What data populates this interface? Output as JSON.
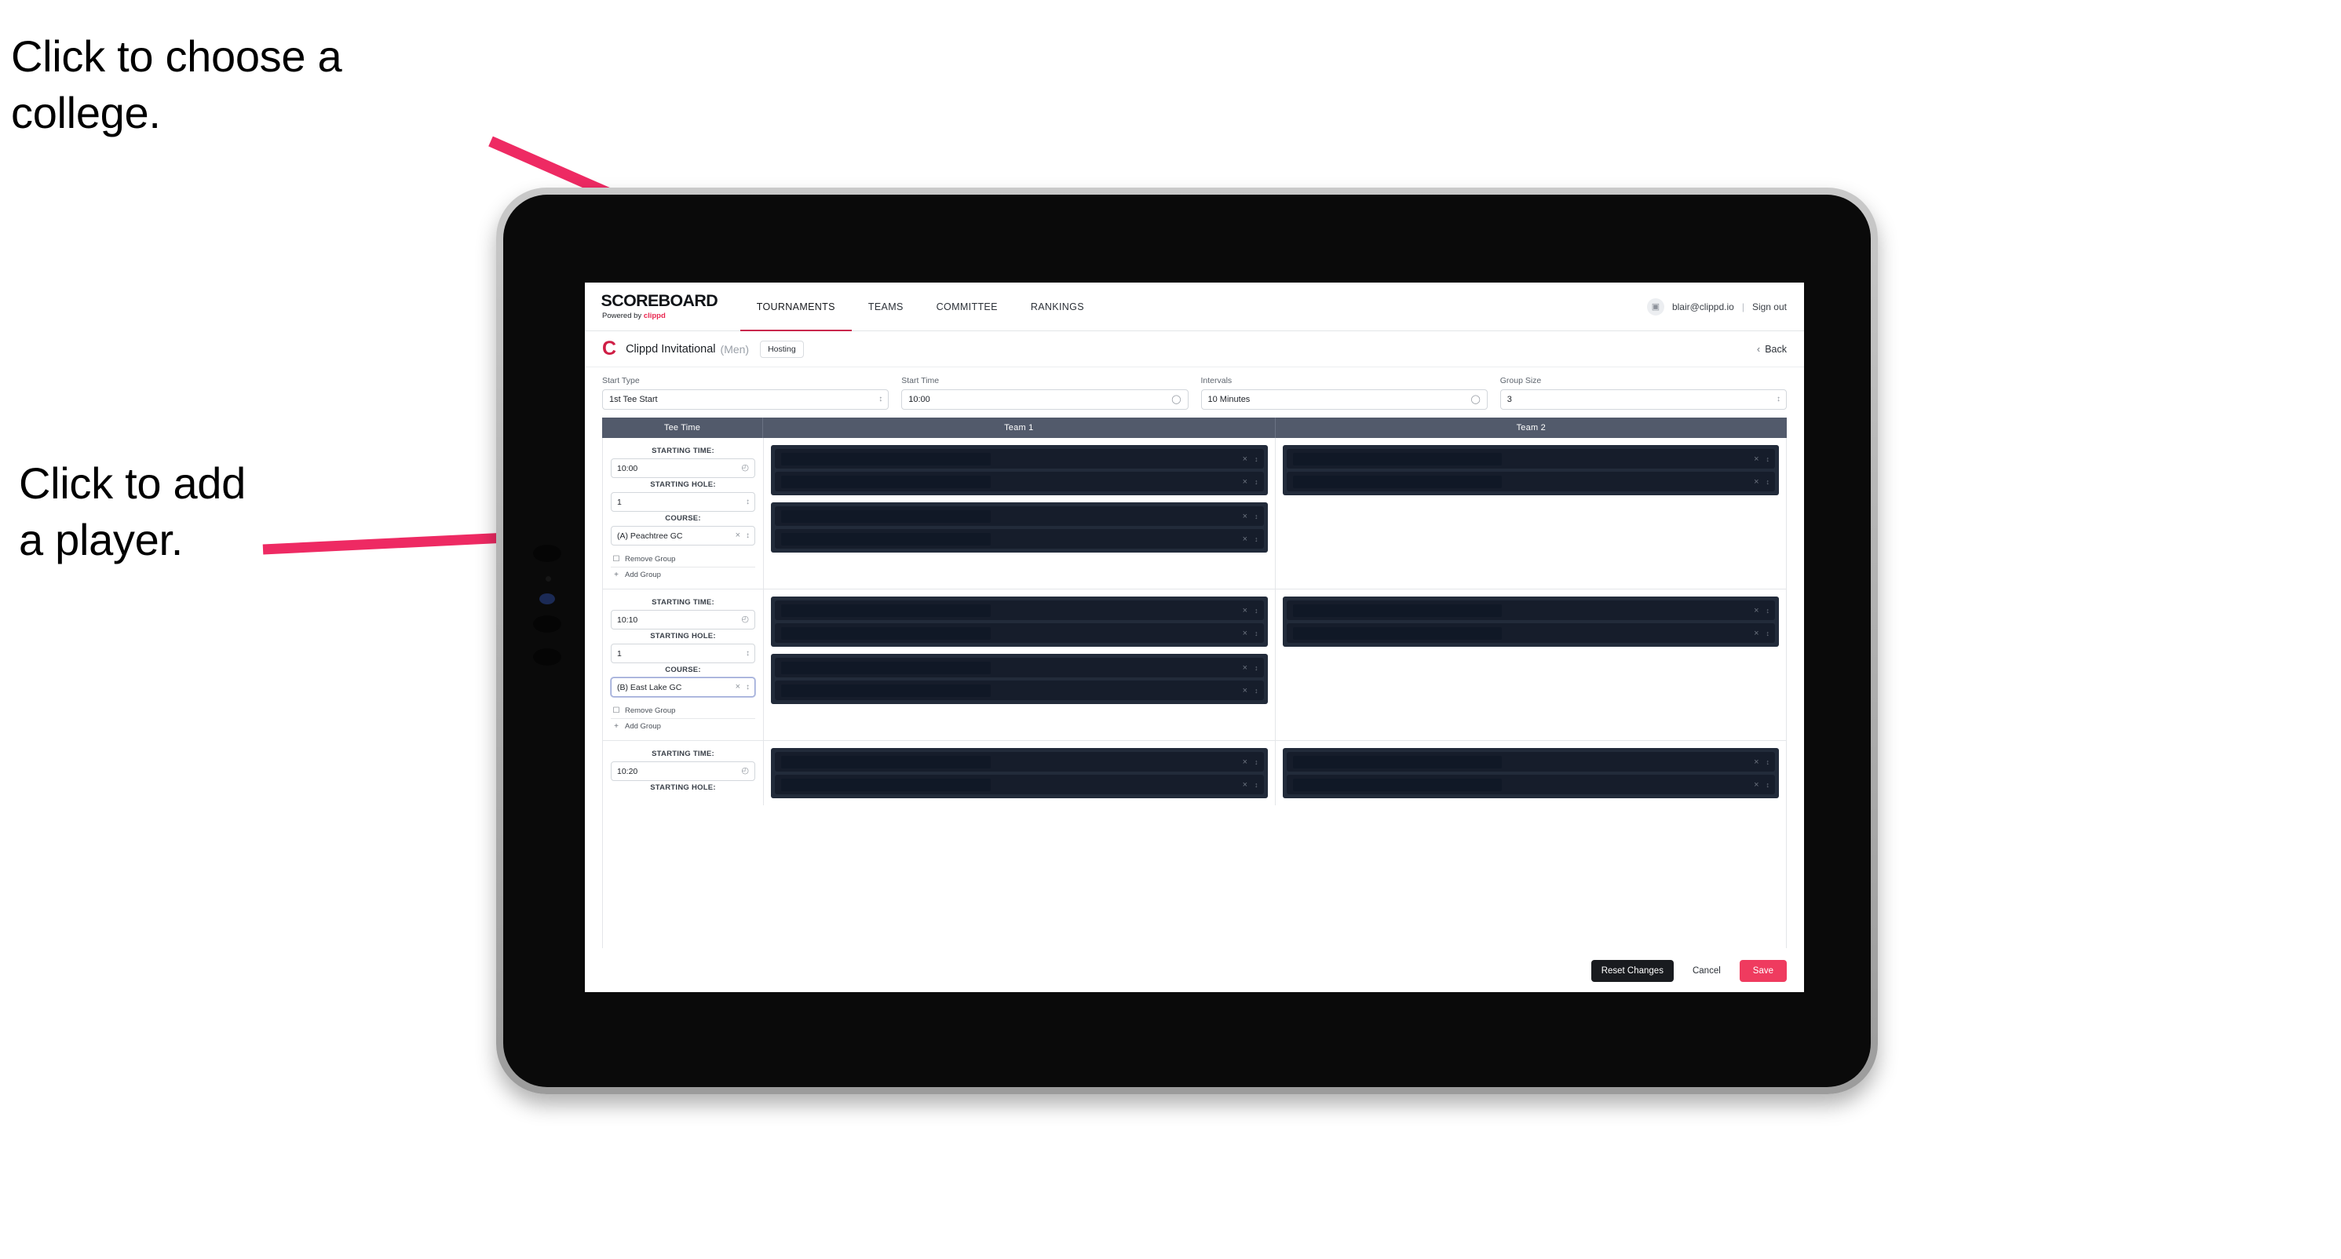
{
  "annotations": {
    "college": "Click to choose a\ncollege.",
    "player": "Click to add\na player.",
    "arrow_color": "#EE2A63"
  },
  "brand": {
    "title": "SCOREBOARD",
    "powered_prefix": "Powered by ",
    "powered_name": "clippd",
    "accent": "#E8264F"
  },
  "nav": {
    "tabs": [
      {
        "label": "TOURNAMENTS",
        "active": true
      },
      {
        "label": "TEAMS",
        "active": false
      },
      {
        "label": "COMMITTEE",
        "active": false
      },
      {
        "label": "RANKINGS",
        "active": false
      }
    ],
    "avatar_icon": "user-avatar-icon",
    "user_email": "blair@clippd.io",
    "separator": "|",
    "sign_out": "Sign out"
  },
  "tournament": {
    "logo_letter": "C",
    "name": "Clippd Invitational",
    "gender": "(Men)",
    "hosting_badge": "Hosting",
    "back_chevron": "‹",
    "back_label": "Back"
  },
  "settings": [
    {
      "label": "Start Type",
      "value": "1st Tee Start",
      "icon": "stepper-icon"
    },
    {
      "label": "Start Time",
      "value": "10:00",
      "icon": "clock-icon"
    },
    {
      "label": "Intervals",
      "value": "10 Minutes",
      "icon": "clock-icon"
    },
    {
      "label": "Group Size",
      "value": "3",
      "icon": "stepper-icon"
    }
  ],
  "grid": {
    "headers": [
      "Tee Time",
      "Team 1",
      "Team 2"
    ],
    "labels": {
      "starting_time": "STARTING TIME:",
      "starting_hole": "STARTING HOLE:",
      "course": "COURSE:",
      "remove_group": "Remove Group",
      "add_group": "Add Group",
      "remove_icon": "trash-icon",
      "add_icon": "plus-icon",
      "clock_icon": "clock-icon",
      "stepper_icon": "stepper-icon",
      "clear_icon": "close-icon"
    },
    "rows": [
      {
        "starting_time": "10:00",
        "starting_hole": "1",
        "course": "(A) Peachtree GC",
        "course_focused": false,
        "team1_groups": [
          {
            "slots": [
              "",
              ""
            ]
          },
          {
            "slots": [
              "",
              ""
            ]
          }
        ],
        "team2_groups": [
          {
            "slots": [
              "",
              ""
            ]
          }
        ]
      },
      {
        "starting_time": "10:10",
        "starting_hole": "1",
        "course": "(B) East Lake GC",
        "course_focused": true,
        "team1_groups": [
          {
            "slots": [
              "",
              ""
            ]
          },
          {
            "slots": [
              "",
              ""
            ]
          }
        ],
        "team2_groups": [
          {
            "slots": [
              "",
              ""
            ]
          }
        ]
      },
      {
        "starting_time": "10:20",
        "starting_hole": "",
        "course": "",
        "course_focused": false,
        "team1_groups": [
          {
            "slots": [
              "",
              ""
            ]
          }
        ],
        "team2_groups": [
          {
            "slots": [
              "",
              ""
            ]
          }
        ]
      }
    ]
  },
  "footer": {
    "reset_label": "Reset Changes",
    "cancel_label": "Cancel",
    "save_label": "Save",
    "save_color": "#EF3B5F"
  }
}
